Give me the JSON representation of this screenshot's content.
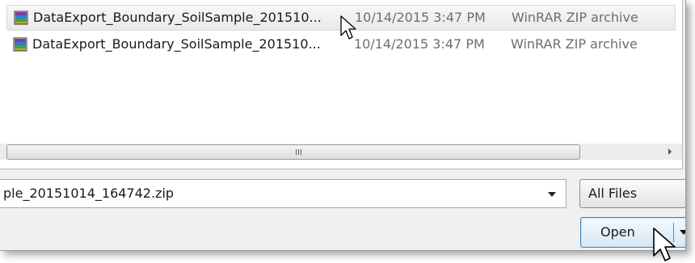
{
  "file_list": {
    "rows": [
      {
        "name": "DataExport_Boundary_SoilSample_201510...",
        "date": "10/14/2015 3:47 PM",
        "type": "WinRAR ZIP archive",
        "icon": "winrar-archive-icon"
      },
      {
        "name": "DataExport_Boundary_SoilSample_201510...",
        "date": "10/14/2015 3:47 PM",
        "type": "WinRAR ZIP archive",
        "icon": "winrar-archive-icon"
      }
    ],
    "scroll_grip": "III"
  },
  "filename_combo": {
    "value": "ple_20151014_164742.zip"
  },
  "file_type_filter": {
    "value": "All Files"
  },
  "open_button": {
    "label": "Open"
  },
  "colors": {
    "button_border": "#3c7fb1",
    "row_hover": "#ececec",
    "secondary_text": "#6e6e6e"
  }
}
